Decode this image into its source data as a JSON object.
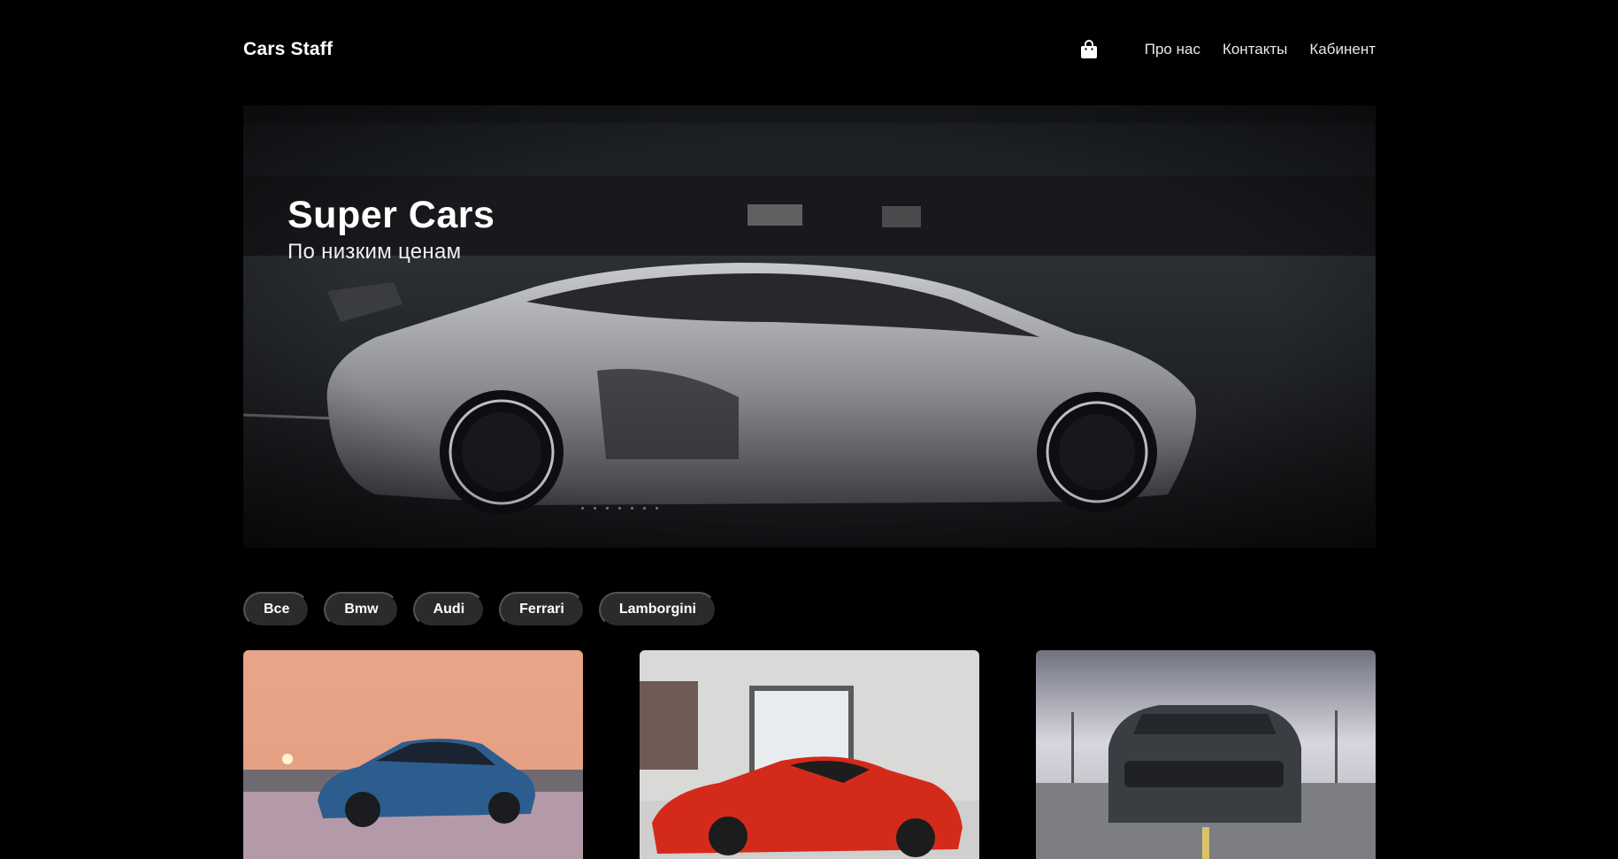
{
  "header": {
    "logo": "Cars Staff",
    "nav": [
      "Про нас",
      "Контакты",
      "Кабинент"
    ]
  },
  "hero": {
    "title": "Super Cars",
    "subtitle": "По низким ценам",
    "slides": 7
  },
  "filters": [
    "Все",
    "Bmw",
    "Audi",
    "Ferrari",
    "Lamborgini"
  ],
  "icons": {
    "cart": "shopping-bag-icon"
  },
  "colors": {
    "background": "#000000",
    "chip": "#2b2b2b",
    "text": "#ffffff"
  }
}
